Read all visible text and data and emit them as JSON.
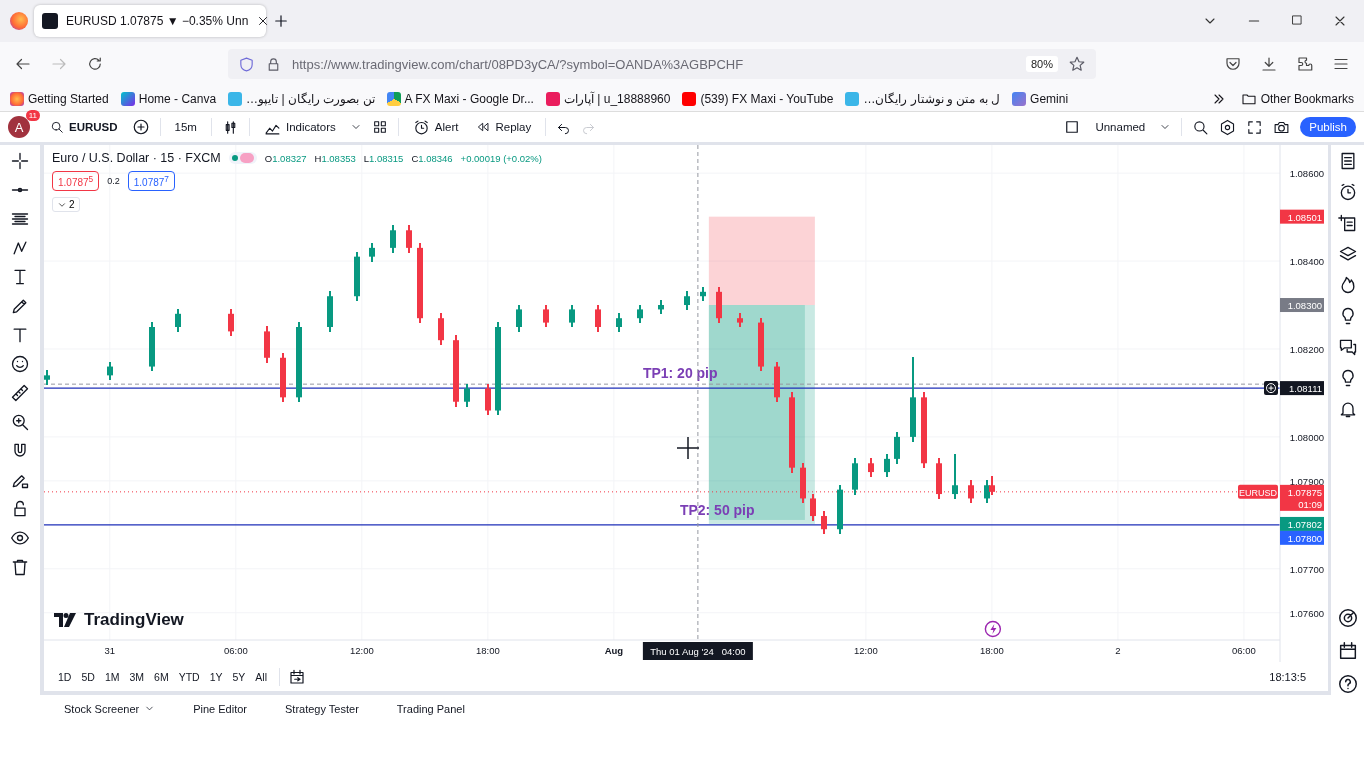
{
  "browser": {
    "tab": {
      "title": "EURUSD 1.07875 ▼ −0.35% Unn",
      "selected": true
    },
    "url": "https://www.tradingview.com/chart/08PD3yCA/?symbol=OANDA%3AGBPCHF",
    "zoom": "80%",
    "bookmarks": [
      {
        "label": "Getting Started",
        "kind": "firefox"
      },
      {
        "label": "Home - Canva",
        "kind": "canva"
      },
      {
        "label": "…تن بصورت رایگان | تایپو",
        "kind": "app"
      },
      {
        "label": "A FX Maxi - Google Dr...",
        "kind": "drive"
      },
      {
        "label": "آپارات | u_18888960",
        "kind": "aparat"
      },
      {
        "label": "(539) FX Maxi - YouTube",
        "kind": "youtube"
      },
      {
        "label": "…ل به متن و نوشتار رایگان",
        "kind": "app"
      },
      {
        "label": "Gemini",
        "kind": "gemini"
      }
    ],
    "other_bookmarks": "Other Bookmarks"
  },
  "toolbar": {
    "avatar": "A",
    "badge": "11",
    "symbol": "EURUSD",
    "interval": "15m",
    "indicators": "Indicators",
    "alert": "Alert",
    "replay": "Replay",
    "layout_name": "Unnamed",
    "publish": "Publish"
  },
  "legend": {
    "title": "Euro / U.S. Dollar · 15 · FXCM",
    "ohlc": [
      {
        "key": "O",
        "value": "1.08327"
      },
      {
        "key": "H",
        "value": "1.08353"
      },
      {
        "key": "L",
        "value": "1.08315"
      },
      {
        "key": "C",
        "value": "1.08346"
      }
    ],
    "change": "+0.00019 (+0.02%)",
    "sell": "1.0787$^{5}$",
    "spread": "0.2",
    "buy": "1.0787$^{7}$",
    "collapsed_count": "2"
  },
  "chart": {
    "watermark": "TradingView",
    "crosshair_label": "Thu 01 Aug '24   04:00",
    "targets": [
      {
        "label": "TP1: 20 pip"
      },
      {
        "label": "TP2: 50 pip"
      }
    ],
    "price_tags": [
      {
        "kind": "stop",
        "text": "1.08501"
      },
      {
        "kind": "entry",
        "text": "1.08300"
      },
      {
        "kind": "crosshair",
        "text": "1.08111"
      },
      {
        "kind": "last",
        "text": "1.07875",
        "countdown": "01:09"
      },
      {
        "kind": "target",
        "text": "1.07802"
      },
      {
        "kind": "line",
        "text": "1.07800"
      }
    ],
    "chart_data": {
      "type": "candlestick",
      "grid": true,
      "x": [
        "2024-07-30T21:00",
        "2024-07-31T00:00",
        "2024-07-31T02:00",
        "2024-07-31T03:15",
        "2024-07-31T05:45",
        "2024-07-31T07:30",
        "2024-07-31T08:15",
        "2024-07-31T09:00",
        "2024-07-31T10:30",
        "2024-07-31T11:45",
        "2024-07-31T12:30",
        "2024-07-31T13:30",
        "2024-07-31T14:15",
        "2024-07-31T14:45",
        "2024-07-31T15:45",
        "2024-07-31T16:30",
        "2024-07-31T17:00",
        "2024-07-31T18:00",
        "2024-07-31T18:30",
        "2024-07-31T19:30",
        "2024-07-31T20:45",
        "2024-07-31T22:00",
        "2024-07-31T23:15",
        "2024-08-01T00:15",
        "2024-08-01T01:15",
        "2024-08-01T02:15",
        "2024-08-01T03:30",
        "2024-08-01T04:15",
        "2024-08-01T05:00",
        "2024-08-01T06:00",
        "2024-08-01T07:00",
        "2024-08-01T07:45",
        "2024-08-01T08:30",
        "2024-08-01T09:00",
        "2024-08-01T09:30",
        "2024-08-01T10:00",
        "2024-08-01T10:45",
        "2024-08-01T11:30",
        "2024-08-01T12:15",
        "2024-08-01T13:00",
        "2024-08-01T13:30",
        "2024-08-01T14:15",
        "2024-08-01T14:45",
        "2024-08-01T15:30",
        "2024-08-01T16:15",
        "2024-08-01T17:00",
        "2024-08-01T17:45",
        "2024-08-01T18:00"
      ],
      "series": [
        {
          "name": "EURUSD",
          "ohlc": [
            [
              1.0813,
              1.0815,
              1.0812,
              1.0814
            ],
            [
              1.0814,
              1.0817,
              1.0813,
              1.0816
            ],
            [
              1.0816,
              1.0826,
              1.0815,
              1.0825
            ],
            [
              1.0825,
              1.0829,
              1.0824,
              1.0828
            ],
            [
              1.0828,
              1.0829,
              1.0823,
              1.0824
            ],
            [
              1.0824,
              1.0825,
              1.0817,
              1.0818
            ],
            [
              1.0818,
              1.0819,
              1.0808,
              1.0809
            ],
            [
              1.0809,
              1.0826,
              1.0808,
              1.0825
            ],
            [
              1.0825,
              1.0833,
              1.0824,
              1.0832
            ],
            [
              1.0832,
              1.0842,
              1.0831,
              1.0841
            ],
            [
              1.0841,
              1.0844,
              1.084,
              1.0843
            ],
            [
              1.0843,
              1.0848,
              1.0842,
              1.0847
            ],
            [
              1.0847,
              1.0848,
              1.0842,
              1.0843
            ],
            [
              1.0843,
              1.0844,
              1.0826,
              1.0827
            ],
            [
              1.0827,
              1.0828,
              1.0821,
              1.0822
            ],
            [
              1.0822,
              1.0823,
              1.0807,
              1.0808
            ],
            [
              1.0808,
              1.0812,
              1.0807,
              1.0811
            ],
            [
              1.0811,
              1.0812,
              1.0805,
              1.0806
            ],
            [
              1.0806,
              1.0826,
              1.0805,
              1.0825
            ],
            [
              1.0825,
              1.083,
              1.0824,
              1.0829
            ],
            [
              1.0829,
              1.083,
              1.0825,
              1.0826
            ],
            [
              1.0826,
              1.083,
              1.0825,
              1.0829
            ],
            [
              1.0829,
              1.083,
              1.0824,
              1.0825
            ],
            [
              1.0825,
              1.0828,
              1.0824,
              1.0827
            ],
            [
              1.0827,
              1.083,
              1.0826,
              1.0829
            ],
            [
              1.0829,
              1.0831,
              1.0828,
              1.083
            ],
            [
              1.083,
              1.0833,
              1.0829,
              1.0832
            ],
            [
              1.0832,
              1.0834,
              1.0831,
              1.0833
            ],
            [
              1.0833,
              1.0834,
              1.0826,
              1.0827
            ],
            [
              1.0827,
              1.0828,
              1.0825,
              1.0826
            ],
            [
              1.0826,
              1.0827,
              1.0815,
              1.0816
            ],
            [
              1.0816,
              1.0817,
              1.0808,
              1.0809
            ],
            [
              1.0809,
              1.081,
              1.0792,
              1.0793
            ],
            [
              1.0793,
              1.0794,
              1.0785,
              1.0786
            ],
            [
              1.0786,
              1.0787,
              1.0781,
              1.0782
            ],
            [
              1.0782,
              1.0783,
              1.0778,
              1.0779
            ],
            [
              1.0779,
              1.0789,
              1.0778,
              1.0788
            ],
            [
              1.0788,
              1.0795,
              1.0787,
              1.0794
            ],
            [
              1.0794,
              1.0795,
              1.0791,
              1.0792
            ],
            [
              1.0792,
              1.0796,
              1.0791,
              1.0795
            ],
            [
              1.0795,
              1.0801,
              1.0794,
              1.08
            ],
            [
              1.08,
              1.0818,
              1.0799,
              1.0809
            ],
            [
              1.0809,
              1.081,
              1.0793,
              1.0794
            ],
            [
              1.0794,
              1.0795,
              1.0786,
              1.0787
            ],
            [
              1.0787,
              1.0796,
              1.0786,
              1.0789
            ],
            [
              1.0789,
              1.079,
              1.0785,
              1.0786
            ],
            [
              1.0786,
              1.079,
              1.0785,
              1.0789
            ],
            [
              1.0789,
              1.0791,
              1.0787,
              1.07875
            ]
          ]
        }
      ],
      "ref_lines": [
        {
          "axis": "y",
          "value": 1.08111,
          "color": "#1e2fb8"
        },
        {
          "axis": "y",
          "value": 1.078,
          "color": "#1e2fb8"
        },
        {
          "axis": "y",
          "value": 1.07875,
          "color": "#f23645"
        },
        {
          "axis": "y",
          "value": 1.0812,
          "color": "#9598a1"
        },
        {
          "axis": "x",
          "value": "2024-08-01T04:00",
          "color": "#9598a1"
        }
      ],
      "xlim": [
        "2024-07-30T20:52",
        "2024-08-02T07:43"
      ],
      "ylim": [
        1.07538,
        1.08664
      ],
      "xticks": [
        {
          "value": "2024-07-31T00:00",
          "label": "31"
        },
        {
          "value": "2024-07-31T06:00",
          "label": "06:00"
        },
        {
          "value": "2024-07-31T12:00",
          "label": "12:00"
        },
        {
          "value": "2024-07-31T18:00",
          "label": "18:00"
        },
        {
          "value": "2024-08-01T00:00",
          "label": "Aug"
        },
        {
          "value": "2024-08-01T12:00",
          "label": "12:00"
        },
        {
          "value": "2024-08-01T18:00",
          "label": "18:00"
        },
        {
          "value": "2024-08-02T00:00",
          "label": "2"
        },
        {
          "value": "2024-08-02T06:00",
          "label": "06:00"
        }
      ],
      "yticks": [
        {
          "value": 1.086,
          "label": "1.08600"
        },
        {
          "value": 1.084,
          "label": "1.08400"
        },
        {
          "value": 1.082,
          "label": "1.08200"
        },
        {
          "value": 1.08,
          "label": "1.08000"
        },
        {
          "value": 1.079,
          "label": "1.07900"
        },
        {
          "value": 1.077,
          "label": "1.07700"
        },
        {
          "value": 1.076,
          "label": "1.07600"
        }
      ]
    }
  },
  "ranges": [
    "1D",
    "5D",
    "1M",
    "3M",
    "6M",
    "YTD",
    "1Y",
    "5Y",
    "All"
  ],
  "clock": "18:13:5",
  "panels": [
    {
      "label": "Stock Screener",
      "kind": "menu"
    },
    {
      "label": "Pine Editor",
      "kind": "tab"
    },
    {
      "label": "Strategy Tester",
      "kind": "tab"
    },
    {
      "label": "Trading Panel",
      "kind": "tab"
    }
  ]
}
